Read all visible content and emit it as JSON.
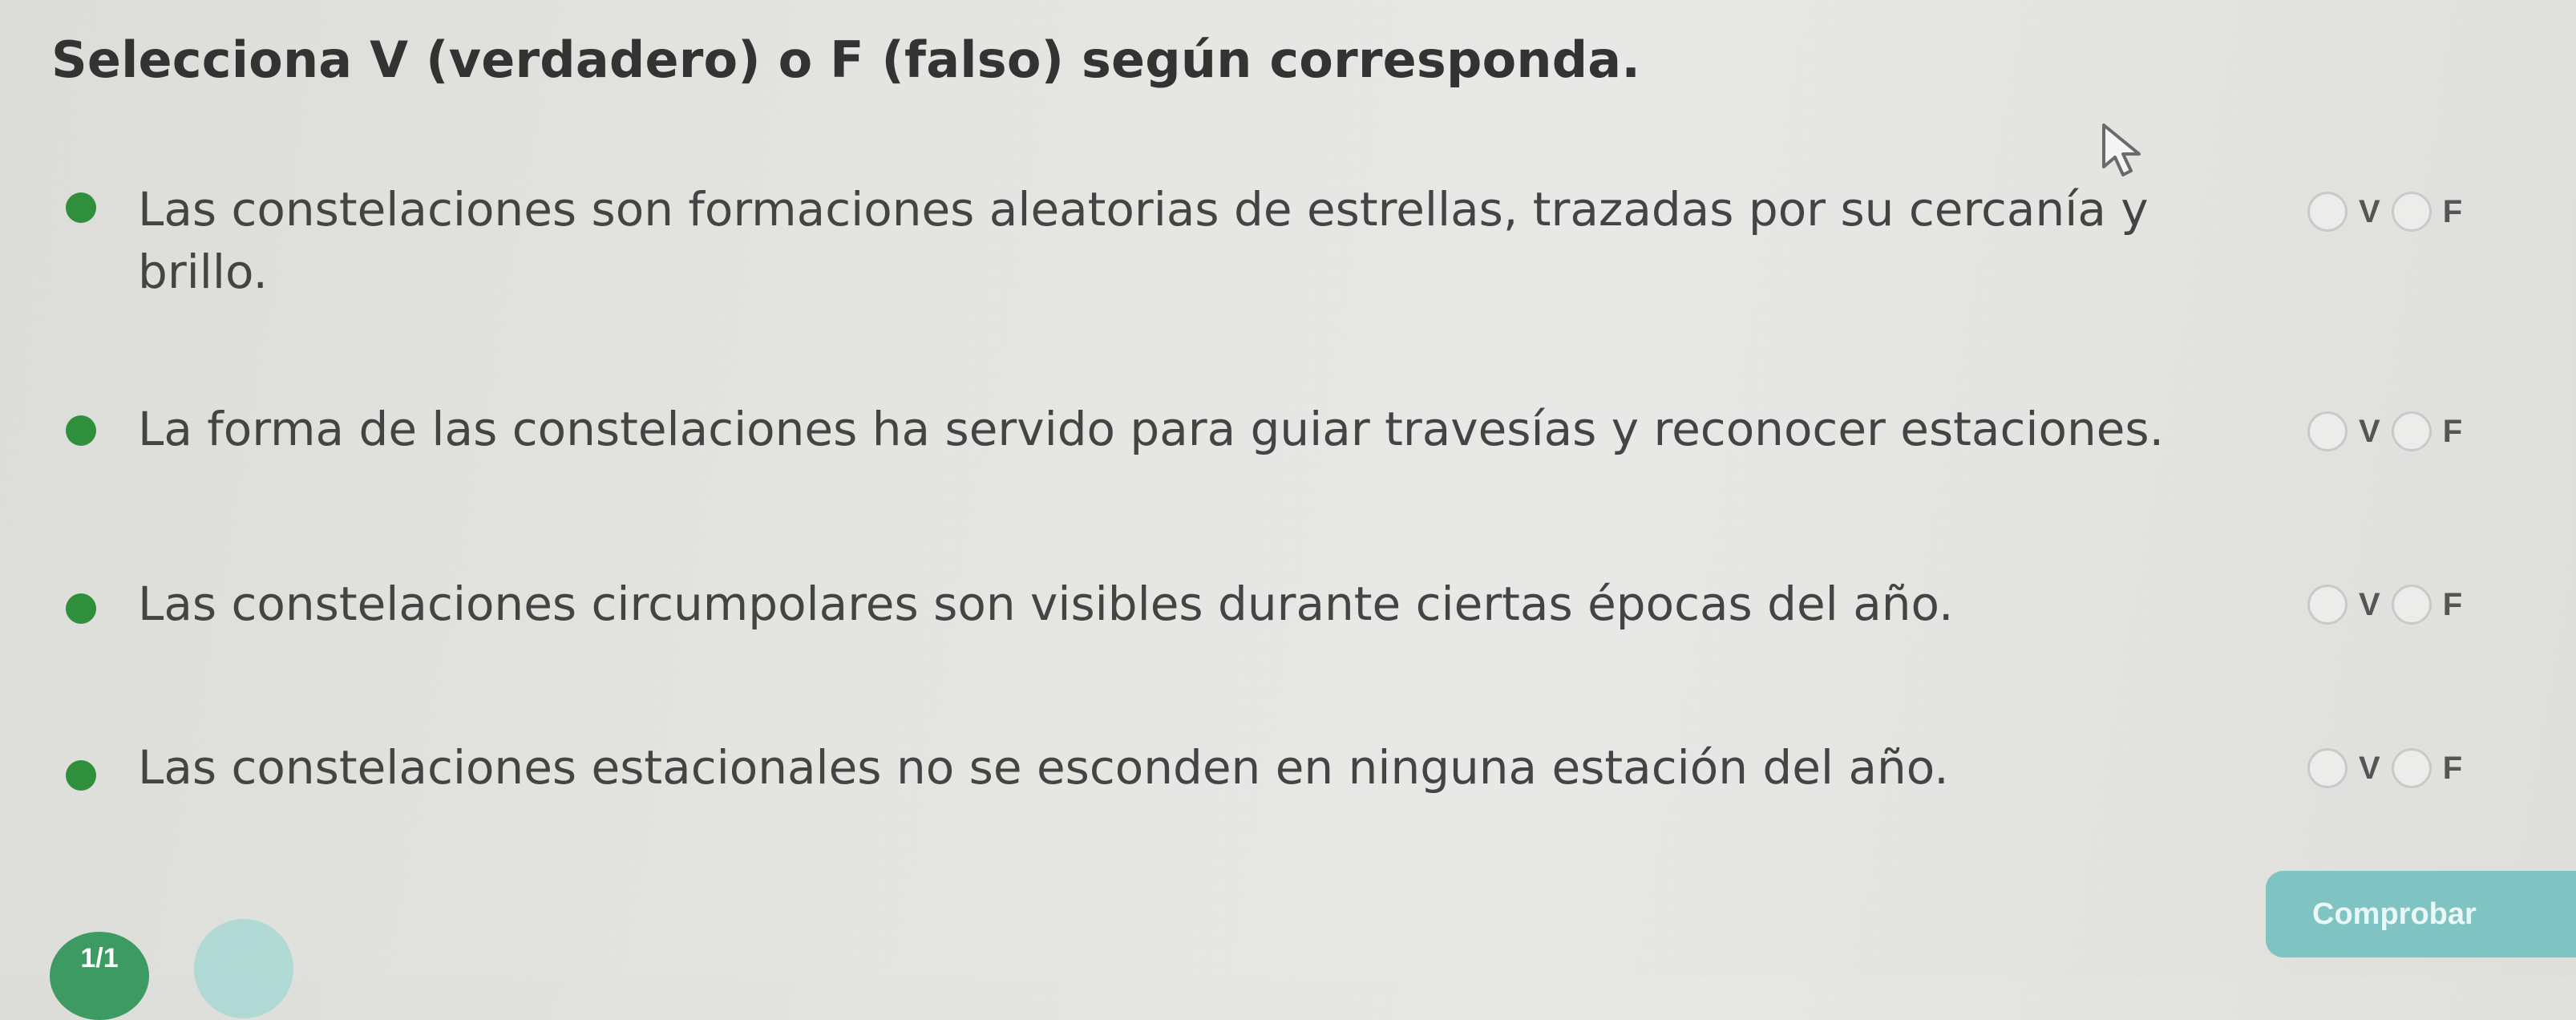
{
  "header": {
    "instruction": "Selecciona V (verdadero) o F (falso) según corresponda."
  },
  "questions": [
    {
      "text": "Las constelaciones son formaciones aleatorias de estrellas, trazadas por su cercanía y brillo.",
      "option_true": "V",
      "option_false": "F"
    },
    {
      "text": "La forma de las constelaciones ha servido para guiar travesías y reconocer estaciones.",
      "option_true": "V",
      "option_false": "F"
    },
    {
      "text": "Las constelaciones circumpolares son visibles durante ciertas épocas del año.",
      "option_true": "V",
      "option_false": "F"
    },
    {
      "text": "Las constelaciones estacionales no se esconden en ninguna estación del año.",
      "option_true": "V",
      "option_false": "F"
    }
  ],
  "footer": {
    "progress": "1/1",
    "check_label": "Comprobar"
  },
  "colors": {
    "bullet": "#2f8f3d",
    "progress_badge": "#3d9a63",
    "check_button": "#7fc4c3"
  },
  "icons": {
    "pointer": "mouse-cursor-icon"
  }
}
